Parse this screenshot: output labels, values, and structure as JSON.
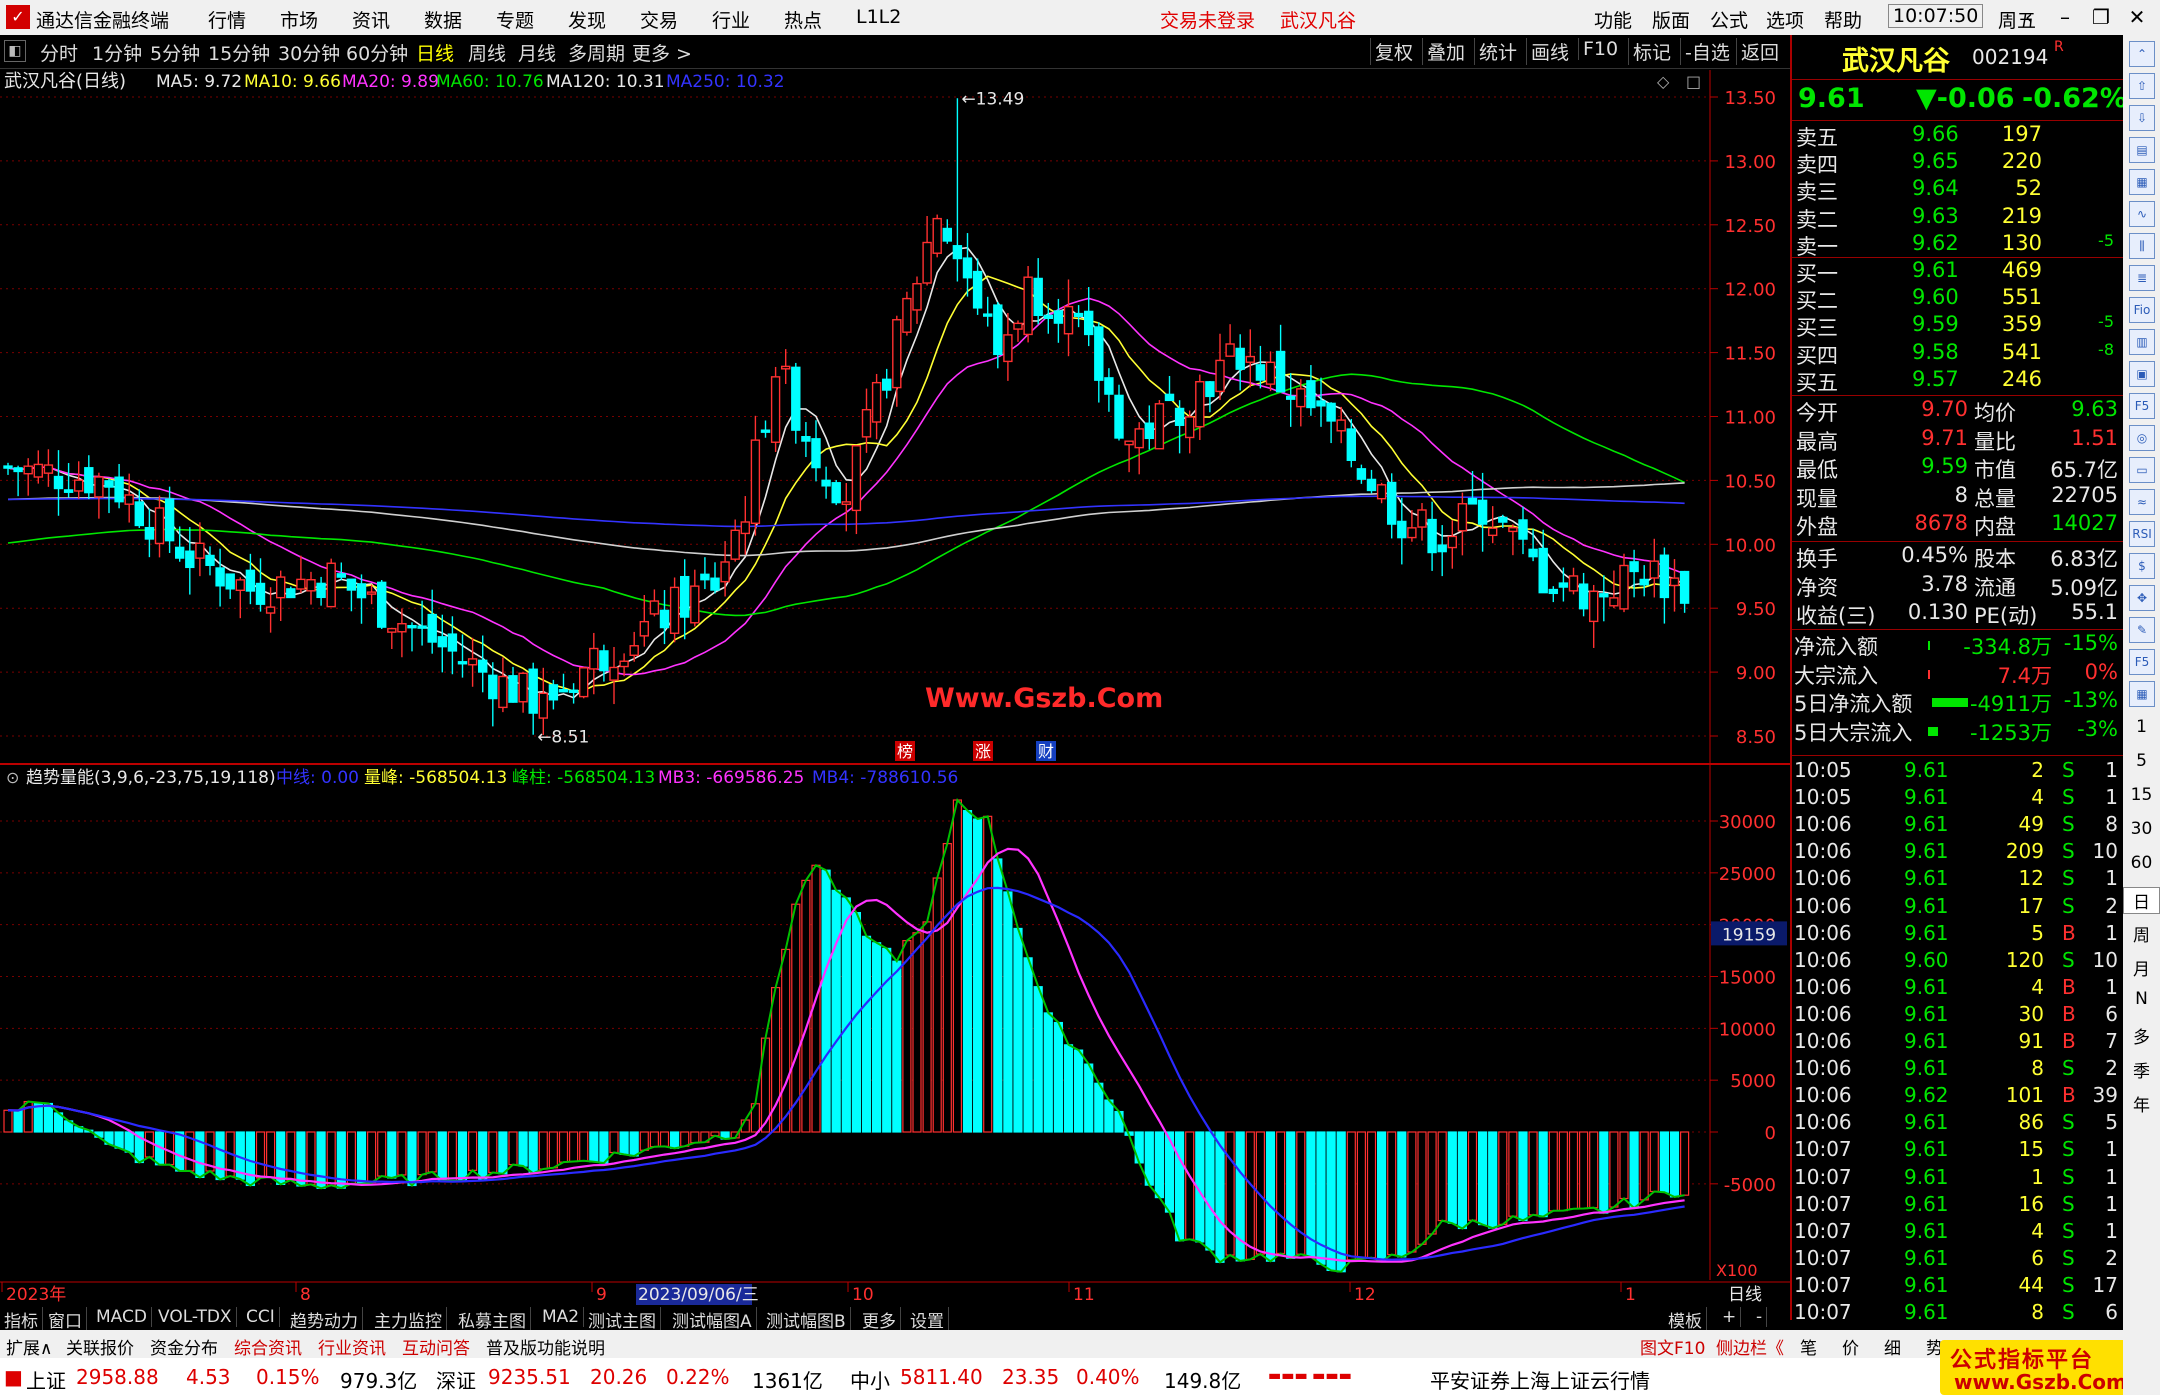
{
  "app": {
    "title": "通达信金融终端",
    "menus": [
      "行情",
      "市场",
      "资讯",
      "数据",
      "专题",
      "发现",
      "交易",
      "行业",
      "热点",
      "L1L2"
    ],
    "login_status": "交易未登录",
    "stock_title": "武汉凡谷",
    "right_menus": [
      "功能",
      "版面",
      "公式",
      "选项",
      "帮助"
    ],
    "time": "10:07:50",
    "weekday": "周五"
  },
  "toolbar": {
    "periods": [
      "分时",
      "1分钟",
      "5分钟",
      "15分钟",
      "30分钟",
      "60分钟",
      "日线",
      "周线",
      "月线",
      "多周期",
      "更多 >"
    ],
    "selected": "日线",
    "right_buttons": [
      "复权",
      "叠加",
      "统计",
      "画线",
      "F10",
      "标记",
      "-自选",
      "返回"
    ]
  },
  "main": {
    "title": "武汉凡谷(日线)",
    "ma": [
      {
        "label": "MA5: 9.72",
        "color": "#e8e8e8"
      },
      {
        "label": "MA10: 9.66",
        "color": "#ffff33"
      },
      {
        "label": "MA20: 9.89",
        "color": "#ff33ff"
      },
      {
        "label": "MA60: 10.76",
        "color": "#00e600"
      },
      {
        "label": "MA120: 10.31",
        "color": "#e8e8e8"
      },
      {
        "label": "MA250: 10.32",
        "color": "#3333ff"
      }
    ],
    "high_label": "13.49",
    "low_label": "8.51",
    "watermark": "Www.Gszb.Com",
    "price_ticks": [
      "13.50",
      "13.00",
      "12.50",
      "12.00",
      "11.50",
      "11.00",
      "10.50",
      "10.00",
      "9.50",
      "9.00",
      "8.50"
    ],
    "markers": [
      "榜",
      "涨",
      "财"
    ]
  },
  "sub": {
    "title": "趋势量能(3,9,6,-23,75,19,118)",
    "items": [
      {
        "label": "中线: 0.00",
        "color": "#3333ff"
      },
      {
        "label": "量峰: -568504.13",
        "color": "#ffff33"
      },
      {
        "label": "峰柱: -568504.13",
        "color": "#00e600"
      },
      {
        "label": "MB3: -669586.25",
        "color": "#ff33ff"
      },
      {
        "label": "MB4: -788610.56",
        "color": "#3333ff"
      }
    ],
    "ticks": [
      "30000",
      "25000",
      "20000",
      "15000",
      "10000",
      "5000",
      "0",
      "-5000"
    ],
    "current_value": "19159",
    "scale": "X100"
  },
  "xaxis": {
    "labels": [
      "2023年",
      "8",
      "9",
      "2023/09/06/三",
      "10",
      "11",
      "12",
      "1"
    ],
    "period": "日线"
  },
  "bottom_tabs": [
    "指标",
    "窗口",
    "MACD",
    "VOL-TDX",
    "CCI",
    "趋势动力",
    "主力监控",
    "私募主图",
    "MA2",
    "测试主图",
    "测试幅图A",
    "测试幅图B",
    "更多",
    "设置"
  ],
  "bottom_right": [
    "模板",
    "+",
    "-"
  ],
  "bottom_tabs2": [
    "扩展∧",
    "关联报价",
    "资金分布",
    "综合资讯",
    "行业资讯",
    "互动问答",
    "普及版功能说明"
  ],
  "bottom_right2": [
    "图文F10",
    "侧边栏《",
    "笔",
    "价",
    "细",
    "势"
  ],
  "quote": {
    "name": "武汉凡谷",
    "code": "002194",
    "flag": "R",
    "price": "9.61",
    "change": "▼-0.06",
    "pct": "-0.62%",
    "asks": [
      [
        "卖五",
        "9.66",
        "197",
        ""
      ],
      [
        "卖四",
        "9.65",
        "220",
        ""
      ],
      [
        "卖三",
        "9.64",
        "52",
        ""
      ],
      [
        "卖二",
        "9.63",
        "219",
        ""
      ],
      [
        "卖一",
        "9.62",
        "130",
        "-5"
      ]
    ],
    "bids": [
      [
        "买一",
        "9.61",
        "469",
        ""
      ],
      [
        "买二",
        "9.60",
        "551",
        ""
      ],
      [
        "买三",
        "9.59",
        "359",
        "-5"
      ],
      [
        "买四",
        "9.58",
        "541",
        "-8"
      ],
      [
        "买五",
        "9.57",
        "246",
        ""
      ]
    ],
    "stats": [
      [
        "今开",
        "9.70",
        "均价",
        "9.63"
      ],
      [
        "最高",
        "9.71",
        "量比",
        "1.51"
      ],
      [
        "最低",
        "9.59",
        "市值",
        "65.7亿"
      ],
      [
        "现量",
        "8",
        "总量",
        "22705"
      ],
      [
        "外盘",
        "8678",
        "内盘",
        "14027"
      ]
    ],
    "stats2": [
      [
        "换手",
        "0.45%",
        "股本",
        "6.83亿"
      ],
      [
        "净资",
        "3.78",
        "流通",
        "5.09亿"
      ],
      [
        "收益(三)",
        "0.130",
        "PE(动)",
        "55.1"
      ]
    ],
    "flows": [
      [
        "净流入额",
        "-334.8万",
        "-15%"
      ],
      [
        "大宗流入",
        "7.4万",
        "0%"
      ],
      [
        "5日净流入额",
        "-4911万",
        "-13%"
      ],
      [
        "5日大宗流入",
        "-1253万",
        "-3%"
      ]
    ]
  },
  "ticks": [
    [
      "10:05",
      "9.61",
      "2",
      "S",
      "1"
    ],
    [
      "10:05",
      "9.61",
      "4",
      "S",
      "1"
    ],
    [
      "10:06",
      "9.61",
      "49",
      "S",
      "8"
    ],
    [
      "10:06",
      "9.61",
      "209",
      "S",
      "10"
    ],
    [
      "10:06",
      "9.61",
      "12",
      "S",
      "1"
    ],
    [
      "10:06",
      "9.61",
      "17",
      "S",
      "2"
    ],
    [
      "10:06",
      "9.61",
      "5",
      "B",
      "1"
    ],
    [
      "10:06",
      "9.60",
      "120",
      "S",
      "10"
    ],
    [
      "10:06",
      "9.61",
      "4",
      "B",
      "1"
    ],
    [
      "10:06",
      "9.61",
      "30",
      "B",
      "6"
    ],
    [
      "10:06",
      "9.61",
      "91",
      "B",
      "7"
    ],
    [
      "10:06",
      "9.61",
      "8",
      "S",
      "2"
    ],
    [
      "10:06",
      "9.62",
      "101",
      "B",
      "39"
    ],
    [
      "10:06",
      "9.61",
      "86",
      "S",
      "5"
    ],
    [
      "10:07",
      "9.61",
      "15",
      "S",
      "1"
    ],
    [
      "10:07",
      "9.61",
      "1",
      "S",
      "1"
    ],
    [
      "10:07",
      "9.61",
      "16",
      "S",
      "1"
    ],
    [
      "10:07",
      "9.61",
      "4",
      "S",
      "1"
    ],
    [
      "10:07",
      "9.61",
      "6",
      "S",
      "2"
    ],
    [
      "10:07",
      "9.61",
      "44",
      "S",
      "17"
    ],
    [
      "10:07",
      "9.61",
      "8",
      "S",
      "6"
    ]
  ],
  "sidebar": {
    "labels": [
      "RSI",
      "1",
      "5",
      "15",
      "30",
      "60",
      "日",
      "周",
      "月",
      "N",
      "多",
      "季",
      "年"
    ]
  },
  "status": {
    "sh_label": "上证",
    "sh": "2958.88",
    "sh_chg": "4.53",
    "sh_pct": "0.15%",
    "sh_amt": "979.3亿",
    "sz_label": "深证",
    "sz": "9235.51",
    "sz_chg": "20.26",
    "sz_pct": "0.22%",
    "sz_amt": "1361亿",
    "zx_label": "中小",
    "zx": "5811.40",
    "zx_chg": "23.35",
    "zx_pct": "0.40%",
    "zx_amt": "149.8亿",
    "broker": "平安证券上海上证云行情",
    "badge_title": "公式指标平台",
    "badge_url": "www.Gszb.Com"
  },
  "colors": {
    "up": "#ff3030",
    "down": "#00ffff",
    "ma5": "#e8e8e8",
    "ma10": "#ffff33",
    "ma20": "#ff33ff",
    "ma60": "#00e600",
    "ma120": "#cfcfcf",
    "ma250": "#3333ff"
  }
}
